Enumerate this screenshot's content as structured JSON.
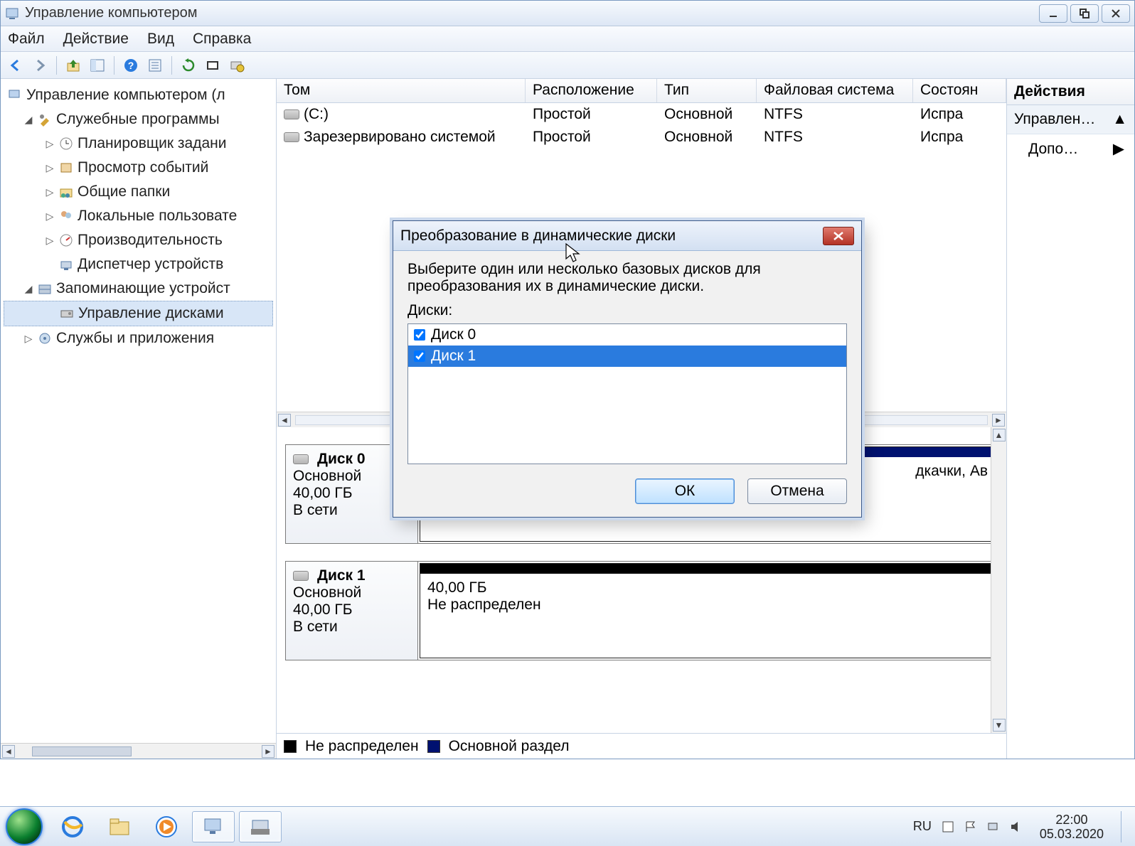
{
  "window": {
    "title": "Управление компьютером"
  },
  "menubar": {
    "file": "Файл",
    "action": "Действие",
    "view": "Вид",
    "help": "Справка"
  },
  "tree": {
    "root": "Управление компьютером (л",
    "sys_tools": "Служебные программы",
    "task_scheduler": "Планировщик задани",
    "event_viewer": "Просмотр событий",
    "shared_folders": "Общие папки",
    "local_users": "Локальные пользовате",
    "performance": "Производительность",
    "device_manager": "Диспетчер устройств",
    "storage": "Запоминающие устройст",
    "disk_mgmt": "Управление дисками",
    "services": "Службы и приложения"
  },
  "columns": {
    "volume": "Том",
    "layout": "Расположение",
    "type": "Тип",
    "fs": "Файловая система",
    "status": "Состоян"
  },
  "volumes": [
    {
      "name": "(C:)",
      "layout": "Простой",
      "type": "Основной",
      "fs": "NTFS",
      "status": "Испра"
    },
    {
      "name": "Зарезервировано системой",
      "layout": "Простой",
      "type": "Основной",
      "fs": "NTFS",
      "status": "Испра"
    }
  ],
  "disks": [
    {
      "title": "Диск 0",
      "kind": "Основной",
      "size": "40,00 ГБ",
      "state": "В сети",
      "parts": [
        {
          "bar": "navy",
          "line1": "",
          "line2": "дкачки, Ав"
        }
      ]
    },
    {
      "title": "Диск 1",
      "kind": "Основной",
      "size": "40,00 ГБ",
      "state": "В сети",
      "parts": [
        {
          "bar": "black",
          "line1": "40,00 ГБ",
          "line2": "Не распределен"
        }
      ]
    }
  ],
  "legend": {
    "unalloc": "Не распределен",
    "primary": "Основной раздел"
  },
  "actions": {
    "header": "Действия",
    "main": "Управлен…",
    "more": "Допо…"
  },
  "dialog": {
    "title": "Преобразование в динамические диски",
    "instruction": "Выберите один или несколько базовых дисков для преобразования их в динамические диски.",
    "list_label": "Диски:",
    "items": [
      {
        "label": "Диск 0",
        "checked": true,
        "selected": false
      },
      {
        "label": "Диск 1",
        "checked": true,
        "selected": true
      }
    ],
    "ok": "ОК",
    "cancel": "Отмена"
  },
  "taskbar": {
    "lang": "RU",
    "time": "22:00",
    "date": "05.03.2020"
  }
}
